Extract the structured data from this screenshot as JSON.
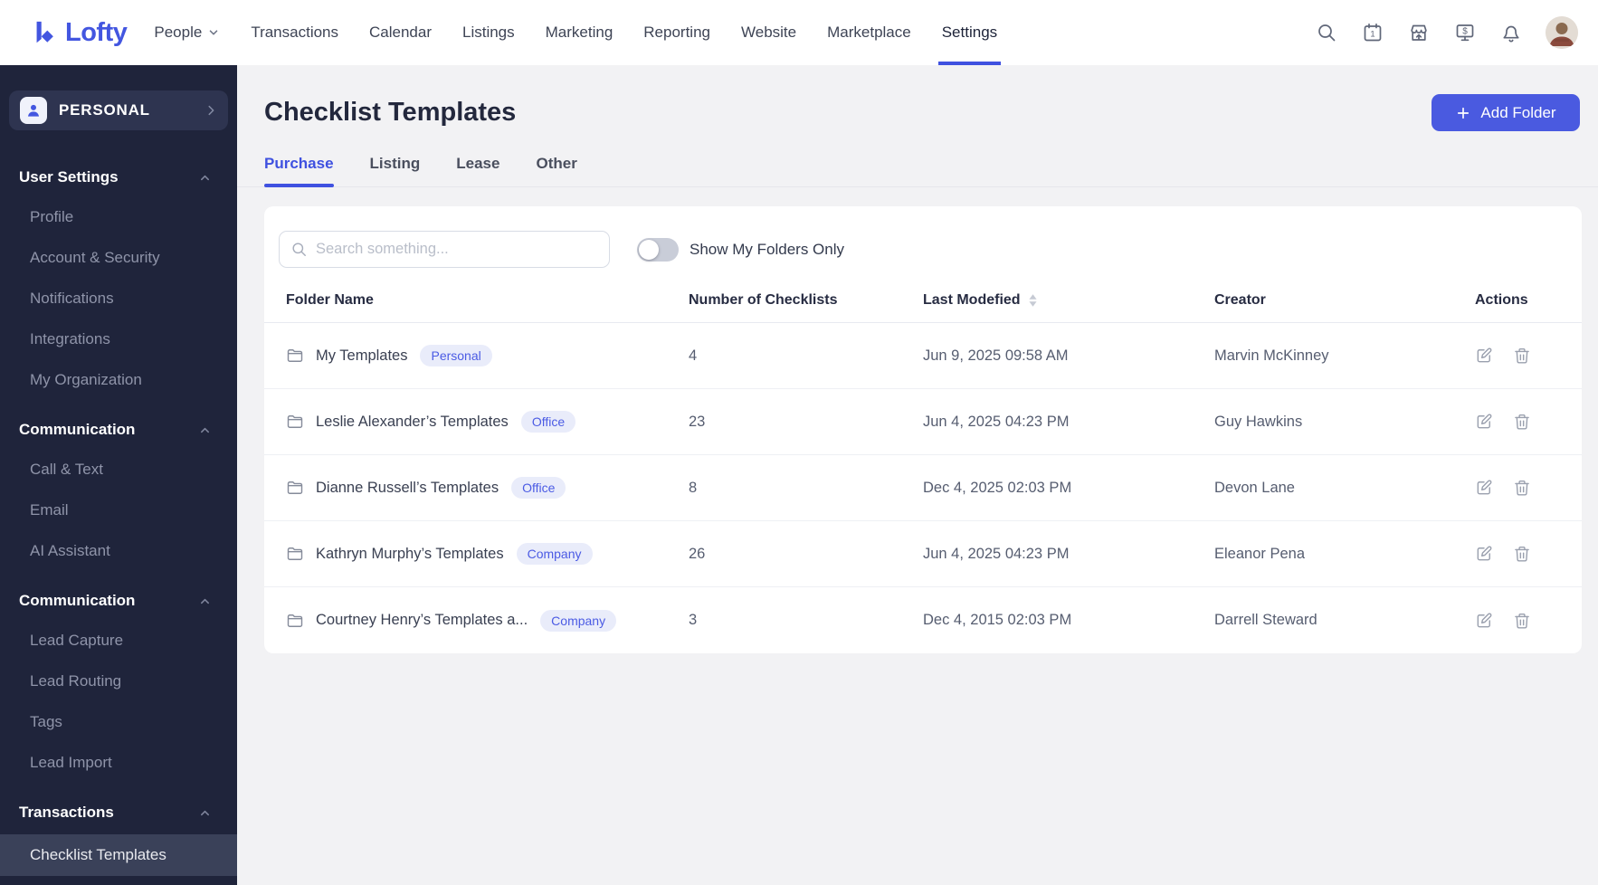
{
  "topnav": {
    "logo_text": "Lofty",
    "items": [
      {
        "label": "People"
      },
      {
        "label": "Transactions"
      },
      {
        "label": "Calendar"
      },
      {
        "label": "Listings"
      },
      {
        "label": "Marketing"
      },
      {
        "label": "Reporting"
      },
      {
        "label": "Website"
      },
      {
        "label": "Marketplace"
      },
      {
        "label": "Settings"
      }
    ],
    "active_item": "Settings",
    "calendar_badge": "1"
  },
  "sidebar": {
    "workspace_label": "PERSONAL",
    "sections": [
      {
        "title": "User Settings",
        "items": [
          "Profile",
          "Account & Security",
          "Notifications",
          "Integrations",
          "My Organization"
        ]
      },
      {
        "title": "Communication",
        "items": [
          "Call & Text",
          "Email",
          "AI Assistant"
        ]
      },
      {
        "title": "Communication",
        "items": [
          "Lead Capture",
          "Lead Routing",
          "Tags",
          "Lead Import"
        ]
      },
      {
        "title": "Transactions",
        "items": [
          "Checklist Templates"
        ],
        "active_item": "Checklist Templates"
      }
    ]
  },
  "main": {
    "page_title": "Checklist Templates",
    "add_folder_button": "Add Folder",
    "tabs": [
      {
        "label": "Purchase"
      },
      {
        "label": "Listing"
      },
      {
        "label": "Lease"
      },
      {
        "label": "Other"
      }
    ],
    "active_tab": "Purchase",
    "search_placeholder": "Search something...",
    "toggle_label": "Show My Folders Only",
    "toggle_state": "off",
    "table": {
      "columns": [
        "Folder Name",
        "Number of Checklists",
        "Last Modefied",
        "Creator",
        "Actions"
      ],
      "sorted_column": "Last Modefied",
      "rows": [
        {
          "name": "My Templates",
          "badge": "Personal",
          "count": "4",
          "modified": "Jun 9, 2025 09:58 AM",
          "creator": "Marvin McKinney"
        },
        {
          "name": "Leslie Alexander’s Templates",
          "badge": "Office",
          "count": "23",
          "modified": "Jun 4, 2025 04:23 PM",
          "creator": "Guy Hawkins"
        },
        {
          "name": "Dianne Russell’s Templates",
          "badge": "Office",
          "count": "8",
          "modified": "Dec 4, 2025 02:03 PM",
          "creator": "Devon Lane"
        },
        {
          "name": "Kathryn Murphy’s Templates",
          "badge": "Company",
          "count": "26",
          "modified": "Jun 4, 2025 04:23 PM",
          "creator": "Eleanor Pena"
        },
        {
          "name": "Courtney Henry’s Templates a...",
          "badge": "Company",
          "count": "3",
          "modified": "Dec 4, 2015 02:03 PM",
          "creator": "Darrell Steward"
        }
      ]
    }
  },
  "colors": {
    "accent": "#4356e0",
    "accent_button": "#4a5ae0",
    "sidebar_bg": "#1f243b",
    "sidebar_active_bg": "#3a4159",
    "page_bg": "#f2f2f4",
    "card_bg": "#ffffff",
    "badge_bg": "#e9ecfa",
    "badge_text": "#4b5be4"
  }
}
